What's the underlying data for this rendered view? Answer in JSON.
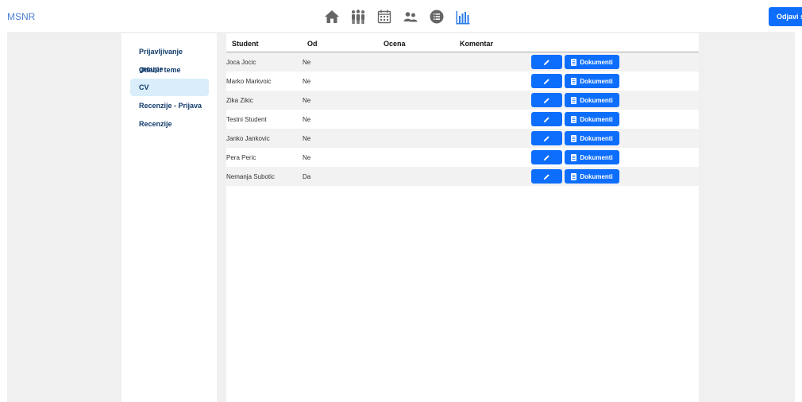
{
  "brand": "MSNR",
  "logout_label": "Odjavi se",
  "nav_icons": [
    "home-icon",
    "people-group-icon",
    "calendar-icon",
    "users-icon",
    "list-circle-icon",
    "bar-chart-icon"
  ],
  "colors": {
    "accent": "#0d6efd",
    "nav_icon": "#666666",
    "nav_active": "#2b7de9",
    "sidebar_text": "#103a6b",
    "sidebar_active": "#d9eefa"
  },
  "sidebar": {
    "items": [
      {
        "label": "Prijavljivanje groupe"
      },
      {
        "label": "Odabir teme"
      },
      {
        "label": "CV",
        "active": true
      },
      {
        "label": "Recenzije - Prijava"
      },
      {
        "label": "Recenzije"
      }
    ]
  },
  "table": {
    "headers": [
      "Student",
      "Od",
      "Ocena",
      "Komentar"
    ],
    "docs_label": "Dokumenti",
    "rows": [
      {
        "student": "Joca Jocic",
        "od": "Ne",
        "ocena": "",
        "komentar": ""
      },
      {
        "student": "Marko Markvoic",
        "od": "Ne",
        "ocena": "",
        "komentar": ""
      },
      {
        "student": "Zika Zikic",
        "od": "Ne",
        "ocena": "",
        "komentar": ""
      },
      {
        "student": "Testni Student",
        "od": "Ne",
        "ocena": "",
        "komentar": ""
      },
      {
        "student": "Janko Jankovic",
        "od": "Ne",
        "ocena": "",
        "komentar": ""
      },
      {
        "student": "Pera Peric",
        "od": "Ne",
        "ocena": "",
        "komentar": ""
      },
      {
        "student": "Nemanja Subotic",
        "od": "Da",
        "ocena": "",
        "komentar": ""
      }
    ]
  }
}
